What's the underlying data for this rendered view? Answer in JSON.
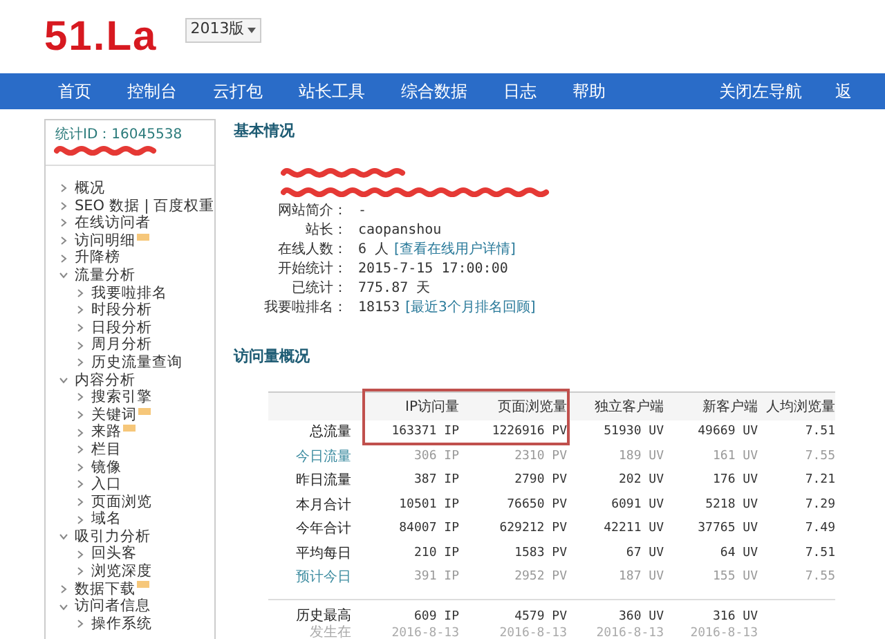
{
  "header": {
    "logo": "51.La",
    "version": "2013版"
  },
  "nav": {
    "items": [
      {
        "label": "首页"
      },
      {
        "label": "控制台"
      },
      {
        "label": "云打包"
      },
      {
        "label": "站长工具"
      },
      {
        "label": "综合数据"
      },
      {
        "label": "日志"
      },
      {
        "label": "帮助"
      }
    ],
    "right_items": [
      {
        "label": "关闭左导航"
      },
      {
        "label": "返"
      }
    ]
  },
  "sidebar": {
    "stat_id_label": "统计ID：",
    "stat_id": "16045538",
    "redacted": [
      {
        "kind": "scribble"
      }
    ],
    "items": [
      {
        "label": "概况"
      },
      {
        "label": "SEO 数据 | 百度权重"
      },
      {
        "label": "在线访问者"
      },
      {
        "label": "访问明细",
        "badge": true
      },
      {
        "label": "升降榜"
      },
      {
        "label": "流量分析",
        "expanded": true,
        "children": [
          {
            "label": "我要啦排名"
          },
          {
            "label": "时段分析"
          },
          {
            "label": "日段分析"
          },
          {
            "label": "周月分析"
          },
          {
            "label": "历史流量查询"
          }
        ]
      },
      {
        "label": "内容分析",
        "expanded": true,
        "children": [
          {
            "label": "搜索引擎"
          },
          {
            "label": "关键词",
            "badge": true
          },
          {
            "label": "来路",
            "badge": true
          },
          {
            "label": "栏目"
          },
          {
            "label": "镜像"
          },
          {
            "label": "入口"
          },
          {
            "label": "页面浏览"
          },
          {
            "label": "域名"
          }
        ]
      },
      {
        "label": "吸引力分析",
        "expanded": true,
        "children": [
          {
            "label": "回头客"
          },
          {
            "label": "浏览深度"
          }
        ]
      },
      {
        "label": "数据下载",
        "badge": true
      },
      {
        "label": "访问者信息",
        "expanded": true,
        "children": [
          {
            "label": "操作系统"
          }
        ]
      }
    ]
  },
  "basic_info": {
    "title": "基本情况",
    "rows": [
      {
        "kind": "redacted"
      },
      {
        "kind": "redacted"
      },
      {
        "kind": "field",
        "label": "网站简介：",
        "value": "-"
      },
      {
        "kind": "field",
        "label": "站长：",
        "value": "caopanshou"
      },
      {
        "kind": "field",
        "label": "在线人数：",
        "value": "6 人",
        "link": "[查看在线用户详情]"
      },
      {
        "kind": "field",
        "label": "开始统计：",
        "value": "2015-7-15 17:00:00"
      },
      {
        "kind": "field",
        "label": "已统计：",
        "value": "775.87 天"
      },
      {
        "kind": "field",
        "label": "我要啦排名：",
        "value": "18153",
        "link": "[最近3个月排名回顾]"
      }
    ]
  },
  "traffic": {
    "title": "访问量概况",
    "columns": [
      {
        "label": "IP访问量",
        "highlighted": true
      },
      {
        "label": "页面浏览量",
        "highlighted": true
      },
      {
        "label": "独立客户端",
        "highlighted": false
      },
      {
        "label": "新客户端",
        "highlighted": false
      },
      {
        "label": "人均浏览量",
        "highlighted": false
      }
    ],
    "rows": [
      {
        "kind": "normal",
        "highlighted": true,
        "label": "总流量",
        "cells": [
          "163371 IP",
          "1226916 PV",
          "51930 UV",
          "49669 UV",
          "7.51"
        ]
      },
      {
        "kind": "link",
        "highlighted": false,
        "label": "今日流量",
        "cells": [
          "306 IP",
          "2310 PV",
          "189 UV",
          "161 UV",
          "7.55"
        ]
      },
      {
        "kind": "normal",
        "highlighted": false,
        "label": "昨日流量",
        "cells": [
          "387 IP",
          "2790 PV",
          "202 UV",
          "176 UV",
          "7.21"
        ]
      },
      {
        "kind": "normal",
        "highlighted": false,
        "label": "本月合计",
        "cells": [
          "10501 IP",
          "76650 PV",
          "6091 UV",
          "5218 UV",
          "7.29"
        ]
      },
      {
        "kind": "normal",
        "highlighted": false,
        "label": "今年合计",
        "cells": [
          "84007 IP",
          "629212 PV",
          "42211 UV",
          "37765 UV",
          "7.49"
        ]
      },
      {
        "kind": "normal",
        "highlighted": false,
        "label": "平均每日",
        "cells": [
          "210 IP",
          "1583 PV",
          "67 UV",
          "64 UV",
          "7.51"
        ]
      },
      {
        "kind": "link",
        "highlighted": false,
        "label": "预计今日",
        "cells": [
          "391 IP",
          "2952 PV",
          "187 UV",
          "155 UV",
          "7.55"
        ]
      }
    ],
    "peak": {
      "label": "历史最高",
      "sublabel": "发生在",
      "cells": [
        {
          "value": "609 IP",
          "date": "2016-8-13"
        },
        {
          "value": "4579 PV",
          "date": "2016-8-13"
        },
        {
          "value": "360 UV",
          "date": "2016-8-13"
        },
        {
          "value": "316 UV",
          "date": "2016-8-13"
        }
      ]
    }
  }
}
